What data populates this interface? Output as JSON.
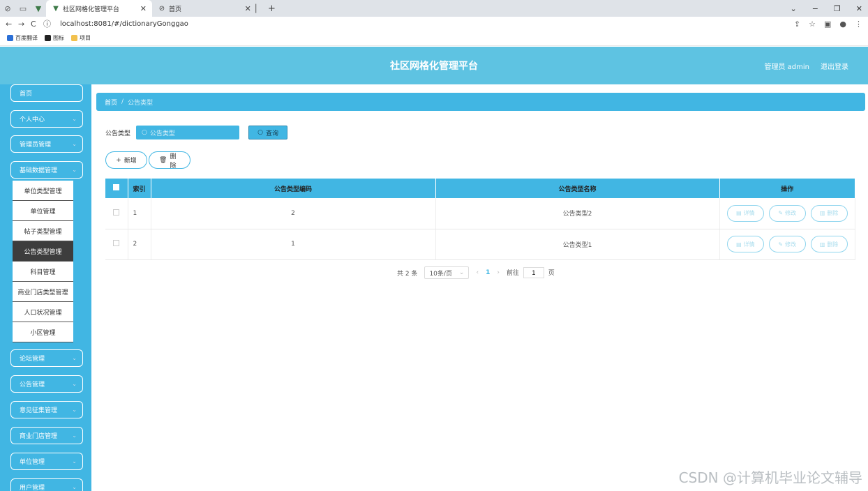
{
  "browser": {
    "tabs": [
      {
        "title": "社区网格化管理平台",
        "active": true
      },
      {
        "title": "首页",
        "active": false
      }
    ],
    "url": "localhost:8081/#/dictionaryGonggao",
    "bookmarks": [
      "百度翻译",
      "图标",
      "项目"
    ]
  },
  "header": {
    "title": "社区网格化管理平台",
    "user": "管理员 admin",
    "logout": "退出登录"
  },
  "sidebar": {
    "items": [
      {
        "label": "首页"
      },
      {
        "label": "个人中心"
      },
      {
        "label": "管理员管理"
      },
      {
        "label": "基础数据管理"
      },
      {
        "label": "论坛管理"
      },
      {
        "label": "公告管理"
      },
      {
        "label": "意见征集管理"
      },
      {
        "label": "商业门店管理"
      },
      {
        "label": "单位管理"
      },
      {
        "label": "用户管理"
      }
    ],
    "submenu": [
      {
        "label": "单位类型管理"
      },
      {
        "label": "单位管理"
      },
      {
        "label": "帖子类型管理"
      },
      {
        "label": "公告类型管理"
      },
      {
        "label": "科目管理"
      },
      {
        "label": "商业门店类型管理"
      },
      {
        "label": "人口状况管理"
      },
      {
        "label": "小区管理"
      }
    ]
  },
  "breadcrumb": {
    "home": "首页",
    "sep": "/",
    "current": "公告类型"
  },
  "search": {
    "label": "公告类型",
    "placeholder": "公告类型",
    "button": "查询"
  },
  "actions": {
    "add": "新增",
    "delete": "删除"
  },
  "table": {
    "headers": [
      "索引",
      "公告类型编码",
      "公告类型名称",
      "操作"
    ],
    "rows": [
      {
        "index": "1",
        "code": "2",
        "name": "公告类型2"
      },
      {
        "index": "2",
        "code": "1",
        "name": "公告类型1"
      }
    ],
    "ops": {
      "detail": "详情",
      "edit": "修改",
      "delete": "删除"
    }
  },
  "pager": {
    "total": "共 2 条",
    "page_size": "10条/页",
    "current_page": "1",
    "goto_label": "前往",
    "goto_value": "1",
    "page_unit": "页"
  },
  "watermark": "CSDN @计算机毕业论文辅导"
}
